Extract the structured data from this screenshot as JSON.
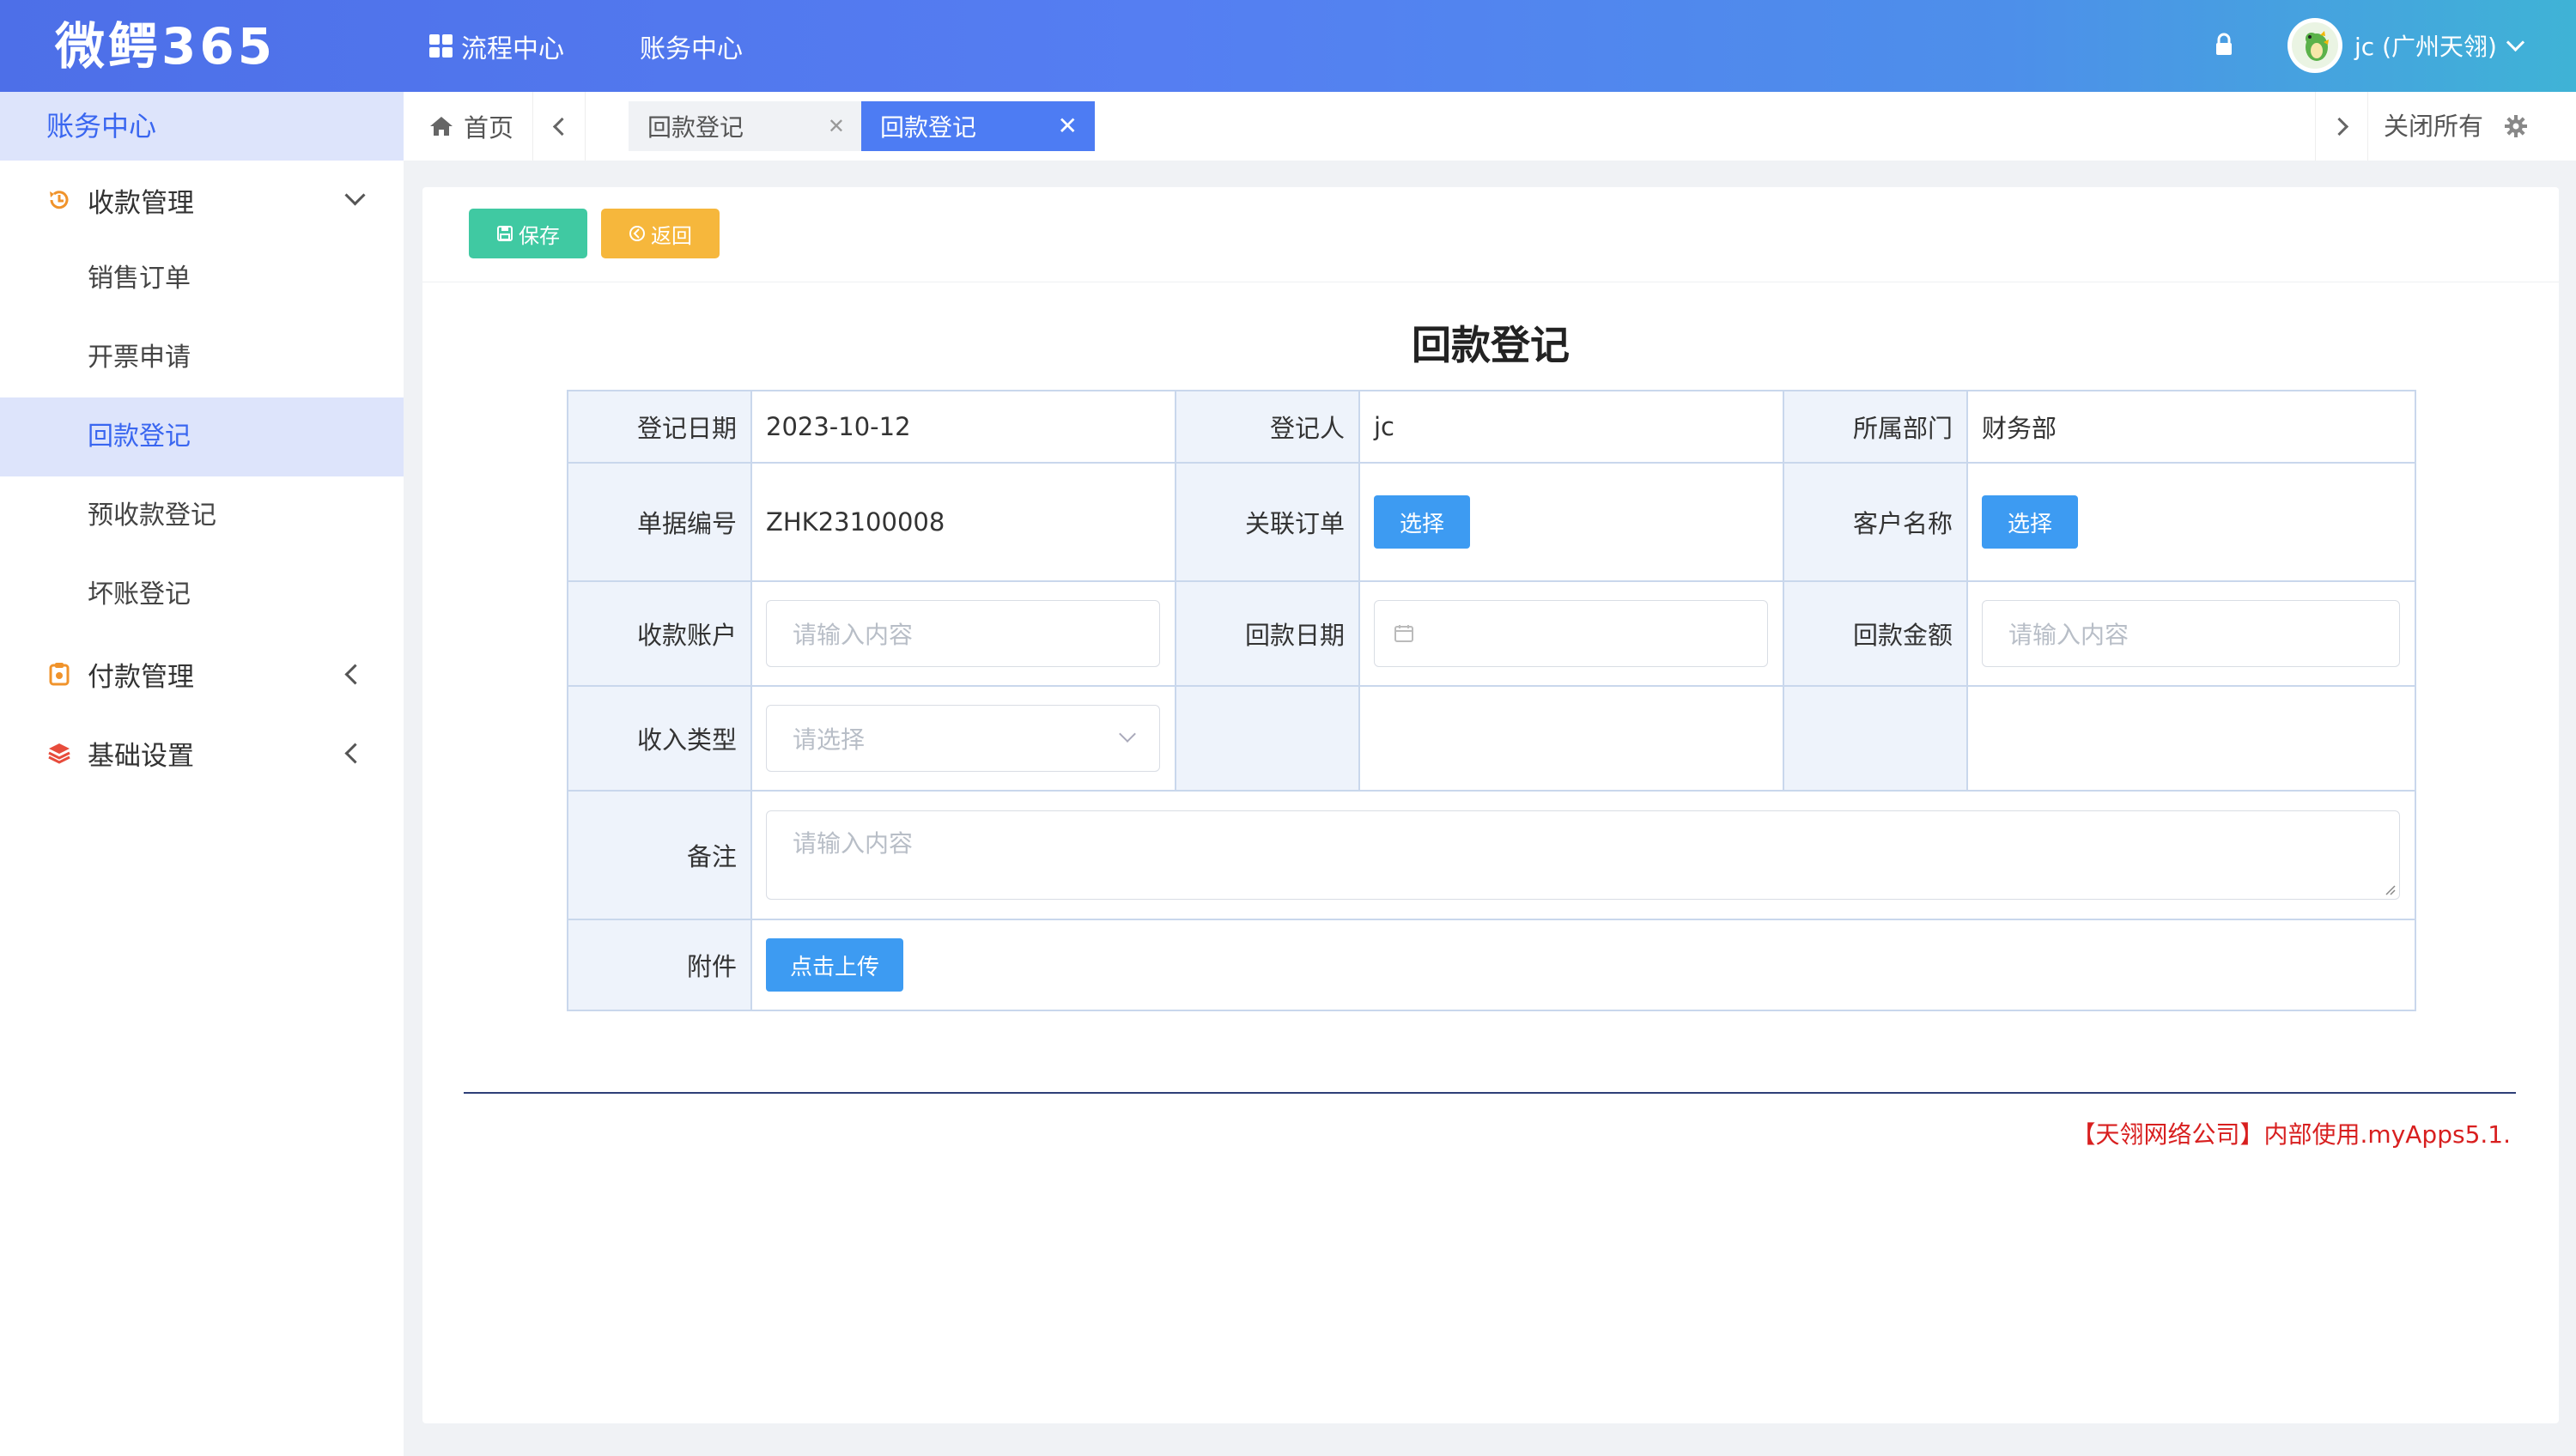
{
  "app": {
    "logo": "微鳄365"
  },
  "topnav": {
    "items": [
      "流程中心",
      "账务中心"
    ]
  },
  "user": {
    "name": "jc (广州天翎)"
  },
  "sidebar": {
    "header": "账务中心",
    "groups": [
      {
        "label": "收款管理",
        "icon": "refresh-clock-icon",
        "expanded": true,
        "items": [
          "销售订单",
          "开票申请",
          "回款登记",
          "预收款登记",
          "坏账登记"
        ]
      },
      {
        "label": "付款管理",
        "icon": "clipboard-icon",
        "expanded": false
      },
      {
        "label": "基础设置",
        "icon": "layers-icon",
        "expanded": false
      }
    ],
    "active_item": "回款登记"
  },
  "tabs": {
    "home": "首页",
    "items": [
      "回款登记",
      "回款登记"
    ],
    "active": 1,
    "close_all": "关闭所有"
  },
  "toolbar": {
    "save_label": "保存",
    "back_label": "返回"
  },
  "form": {
    "title": "回款登记",
    "fields": {
      "reg_date": {
        "label": "登记日期",
        "value": "2023-10-12"
      },
      "registrant": {
        "label": "登记人",
        "value": "jc"
      },
      "department": {
        "label": "所属部门",
        "value": "财务部"
      },
      "doc_no": {
        "label": "单据编号",
        "value": "ZHK23100008"
      },
      "related_order": {
        "label": "关联订单",
        "button": "选择"
      },
      "customer": {
        "label": "客户名称",
        "button": "选择"
      },
      "account": {
        "label": "收款账户",
        "placeholder": "请输入内容"
      },
      "payment_date": {
        "label": "回款日期",
        "placeholder": ""
      },
      "amount": {
        "label": "回款金额",
        "placeholder": "请输入内容"
      },
      "income_type": {
        "label": "收入类型",
        "placeholder": "请选择"
      },
      "remark": {
        "label": "备注",
        "placeholder": "请输入内容"
      },
      "attachment": {
        "label": "附件",
        "button": "点击上传"
      }
    }
  },
  "footer": {
    "text": "【天翎网络公司】内部使用.myApps5.1."
  },
  "colors": {
    "primary": "#4d7cf3",
    "save": "#40c9a2",
    "back": "#f6b73c",
    "action": "#3d9bf2",
    "footer_text": "#d81f1f"
  }
}
